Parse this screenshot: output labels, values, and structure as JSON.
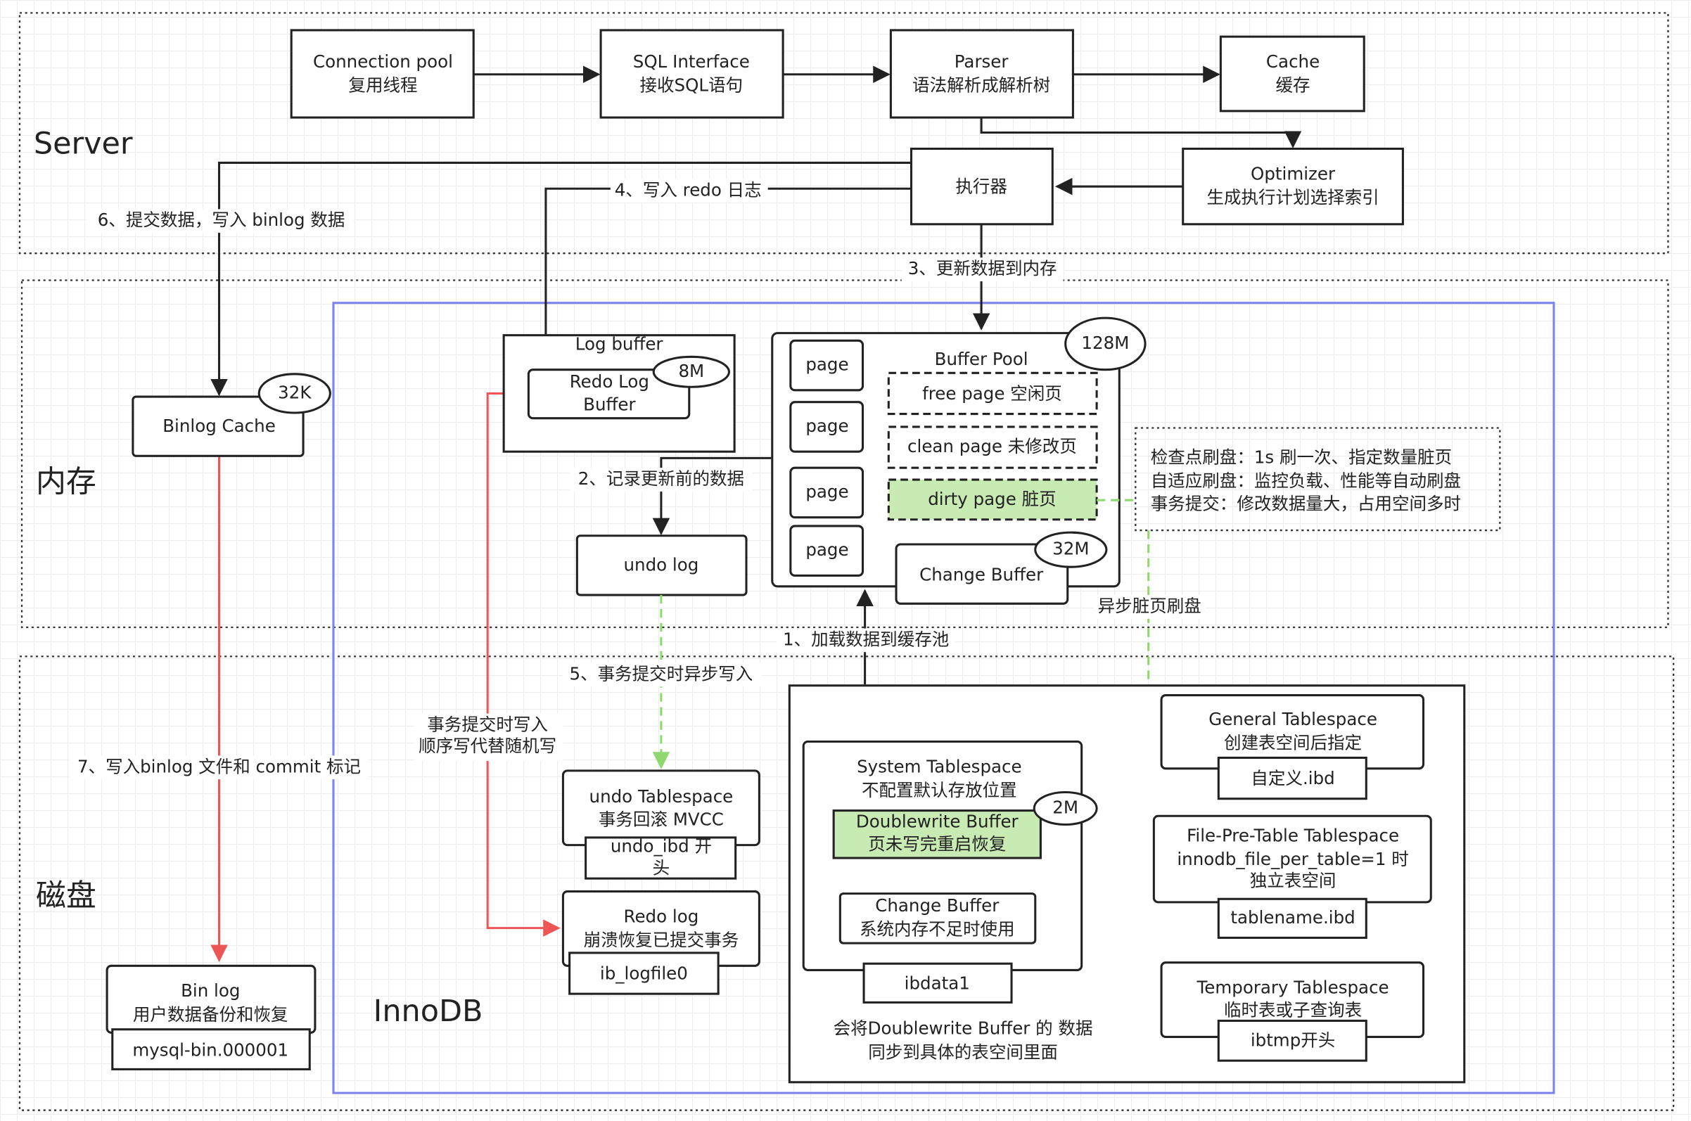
{
  "regions": {
    "server": "Server",
    "memory": "内存",
    "disk": "磁盘",
    "innodb": "InnoDB"
  },
  "server": {
    "connection_pool": [
      "Connection pool",
      "复用线程"
    ],
    "sql_interface": [
      "SQL Interface",
      "接收SQL语句"
    ],
    "parser": [
      "Parser",
      "语法解析成解析树"
    ],
    "cache": [
      "Cache",
      "缓存"
    ],
    "optimizer": [
      "Optimizer",
      "生成执行计划选择索引"
    ],
    "executor": "执行器"
  },
  "steps": {
    "s1": "1、加载数据到缓存池",
    "s2": "2、记录更新前的数据",
    "s3": "3、更新数据到内存",
    "s4": "4、写入 redo 日志",
    "s5": "5、事务提交时异步写入",
    "s6": "6、提交数据，写入 binlog 数据",
    "s7": "7、写入binlog 文件和 commit 标记",
    "redo_commit": [
      "事务提交时写入",
      "顺序写代替随机写"
    ],
    "async_flush": "异步脏页刷盘"
  },
  "memory": {
    "binlog_cache": {
      "label": "Binlog  Cache",
      "size": "32K"
    },
    "log_buffer": {
      "label": "Log buffer",
      "redo_log_buffer": [
        "Redo Log",
        "Buffer"
      ],
      "size": "8M"
    },
    "undo_log": "undo log",
    "buffer_pool": {
      "label": "Buffer Pool",
      "size": "128M",
      "pages": [
        "page",
        "page",
        "page",
        "page"
      ],
      "free_page": "free page 空闲页",
      "clean_page": "clean page 未修改页",
      "dirty_page": "dirty page 脏页"
    },
    "change_buffer": {
      "label": "Change Buffer",
      "size": "32M"
    },
    "flush_note": [
      "检查点刷盘：1s 刷一次、指定数量脏页",
      "自适应刷盘：监控负载、性能等自动刷盘",
      "事务提交：修改数据量大，占用空间多时"
    ]
  },
  "disk": {
    "undo_tablespace": {
      "lines": [
        "undo Tablespace",
        "事务回滚 MVCC"
      ],
      "file": [
        "undo_ibd 开",
        "头"
      ]
    },
    "redo_log": {
      "lines": [
        "Redo log",
        "崩溃恢复已提交事务"
      ],
      "file": "ib_logfile0"
    },
    "bin_log": {
      "lines": [
        "Bin log",
        "用户数据备份和恢复"
      ],
      "file": "mysql-bin.000001"
    },
    "system_tablespace": {
      "lines": [
        "System Tablespace",
        "不配置默认存放位置"
      ],
      "doublewrite": [
        "Doublewrite Buffer",
        "页未写完重启恢复"
      ],
      "doublewrite_size": "2M",
      "change_buffer": [
        "Change Buffer",
        "系统内存不足时使用"
      ],
      "file": "ibdata1"
    },
    "doublewrite_note": [
      "会将Doublewrite Buffer 的 数据",
      "同步到具体的表空间里面"
    ],
    "general_tablespace": {
      "lines": [
        "General Tablespace",
        "创建表空间后指定"
      ],
      "file": "自定义.ibd"
    },
    "file_per_table": {
      "lines": [
        "File-Pre-Table Tablespace",
        "innodb_file_per_table=1 时",
        "独立表空间"
      ],
      "file": "tablename.ibd"
    },
    "temporary_tablespace": {
      "lines": [
        "Temporary Tablespace",
        "临时表或子查询表"
      ],
      "file": "ibtmp开头"
    }
  },
  "colors": {
    "dirty_page": "#c8ebb4",
    "innodb_border": "#7b83ee",
    "red_flow": "#ee5555",
    "green_flow": "#8fd870"
  }
}
